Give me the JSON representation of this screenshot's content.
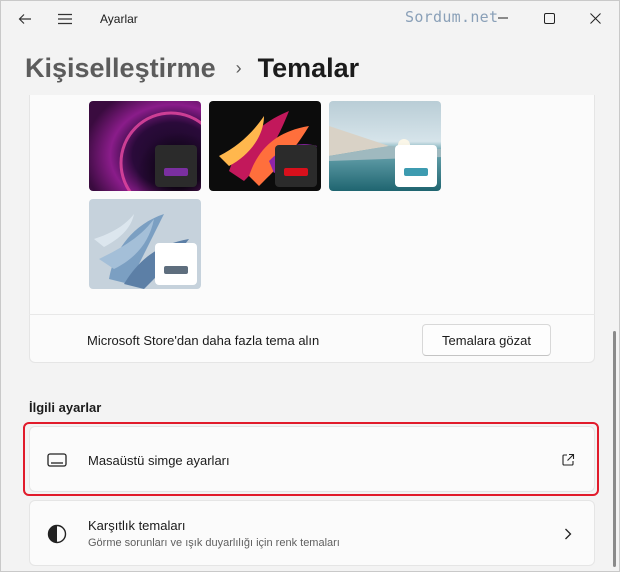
{
  "window": {
    "app_title": "Ayarlar",
    "watermark": "Sordum.net",
    "back_icon": "back-arrow-icon",
    "menu_icon": "hamburger-menu-icon",
    "controls": [
      "minimize-icon",
      "maximize-icon",
      "close-icon"
    ]
  },
  "breadcrumb": {
    "parent": "Kişiselleştirme",
    "separator": "›",
    "current": "Temalar"
  },
  "themes": [
    {
      "name": "dark-glow-theme",
      "accent": "#7a2fa0",
      "badge_bg": "#2b2b2b"
    },
    {
      "name": "flow-theme",
      "accent": "#d8101c",
      "badge_bg": "#2b2b2b"
    },
    {
      "name": "sunrise-lake-theme",
      "accent": "#3d9bb0",
      "badge_bg": "#ffffff"
    },
    {
      "name": "bloom-light-theme",
      "accent": "#5e6e7e",
      "badge_bg": "#ffffff"
    }
  ],
  "store": {
    "text": "Microsoft Store'dan daha fazla tema alın",
    "button_label": "Temalara gözat"
  },
  "related": {
    "section_title": "İlgili ayarlar",
    "items": [
      {
        "title": "Masaüstü simge ayarları",
        "icon": "monitor-icon",
        "trail_icon": "external-link-icon"
      },
      {
        "title": "Karşıtlık temaları",
        "subtitle": "Görme sorunları ve ışık duyarlılığı için renk temaları",
        "icon": "contrast-icon",
        "trail_icon": "chevron-right-icon"
      }
    ]
  },
  "colors": {
    "highlight": "#e11b2b",
    "background": "#f3f3f3",
    "card": "#fbfbfb"
  }
}
